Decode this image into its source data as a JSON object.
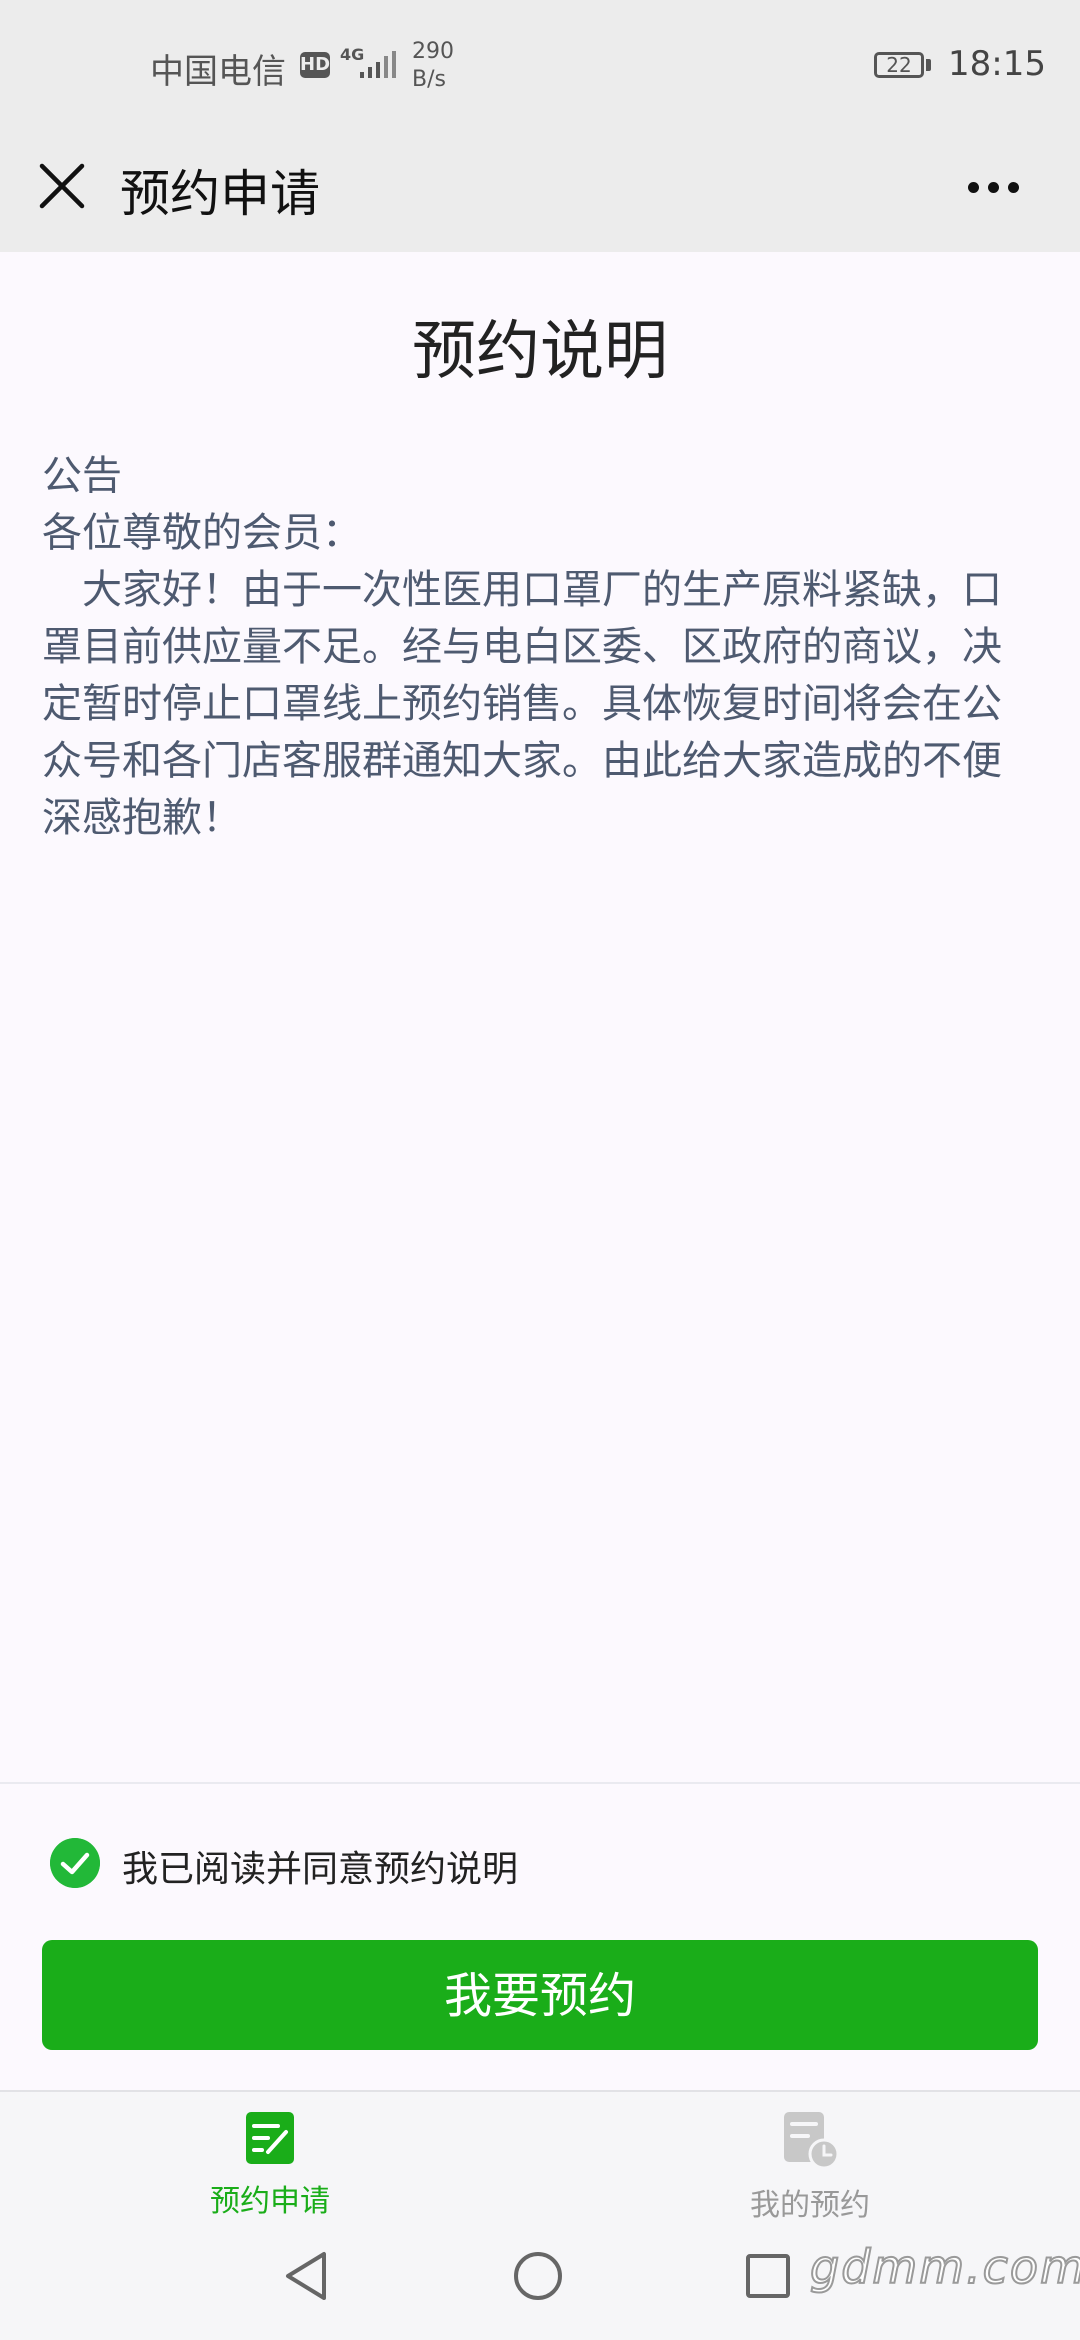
{
  "status_bar": {
    "carrier": "中国电信",
    "hd_badge": "HD",
    "network": "4G",
    "speed_value": "290",
    "speed_unit": "B/s",
    "battery": "22",
    "time": "18:15"
  },
  "header": {
    "title": "预约申请",
    "close_icon": "close-icon",
    "more_icon": "more-icon"
  },
  "content": {
    "title": "预约说明",
    "notice_heading": "公告",
    "salutation": "各位尊敬的会员：",
    "body": "大家好！由于一次性医用口罩厂的生产原料紧缺，口罩目前供应量不足。经与电白区委、区政府的商议，决定暂时停止口罩线上预约销售。具体恢复时间将会在公众号和各门店客服群通知大家。由此给大家造成的不便深感抱歉！"
  },
  "agreement": {
    "checked": true,
    "label": "我已阅读并同意预约说明"
  },
  "action": {
    "button_label": "我要预约"
  },
  "tabs": [
    {
      "label": "预约申请",
      "icon": "edit-doc-icon",
      "active": true
    },
    {
      "label": "我的预约",
      "icon": "doc-clock-icon",
      "active": false
    }
  ],
  "watermark": "gdmm.com",
  "colors": {
    "accent": "#1aad19",
    "header_bg": "#ececec",
    "page_bg": "#fcf9fe",
    "notice_text": "#4e5a70"
  }
}
